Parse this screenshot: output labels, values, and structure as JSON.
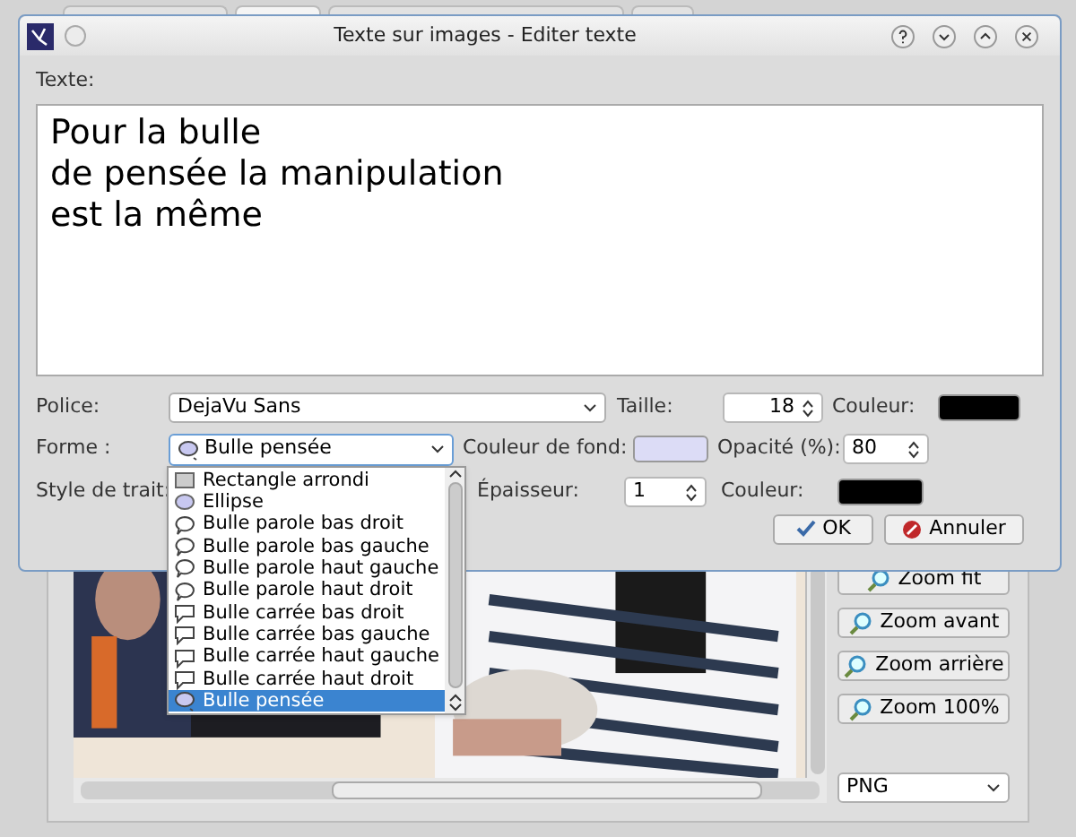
{
  "dialog": {
    "title": "Texte sur images - Editer texte",
    "text_label": "Texte:",
    "text": "Pour la bulle\nde pensée la manipulation\nest la même",
    "font": {
      "label": "Police:",
      "value": "DejaVu Sans"
    },
    "size": {
      "label": "Taille:",
      "value": "18"
    },
    "color": {
      "label": "Couleur:",
      "color": "#000000"
    },
    "shape": {
      "label": "Forme :",
      "value": "Bulle pensée"
    },
    "background_color": {
      "label": "Couleur de fond:",
      "color": "#dcdcf6"
    },
    "opacity": {
      "label": "Opacité (%):",
      "value": "80"
    },
    "stroke_style": {
      "label": "Style de trait:"
    },
    "thickness": {
      "label": "Épaisseur:",
      "value": "1"
    },
    "stroke_color": {
      "label": "Couleur:",
      "color": "#000000"
    },
    "buttons": [
      {
        "label": "OK",
        "kind": "ok"
      },
      {
        "label": "Annuler",
        "kind": "cancel"
      }
    ]
  },
  "shape_list": [
    {
      "label": "Rectangle arrondi",
      "kind": "rect",
      "selected": false
    },
    {
      "label": "Ellipse",
      "kind": "ellipse",
      "selected": false
    },
    {
      "label": "Bulle parole bas droit",
      "kind": "speech",
      "selected": false
    },
    {
      "label": "Bulle parole bas gauche",
      "kind": "speech",
      "selected": false
    },
    {
      "label": "Bulle parole haut gauche",
      "kind": "speech",
      "selected": false
    },
    {
      "label": "Bulle parole haut droit",
      "kind": "speech",
      "selected": false
    },
    {
      "label": "Bulle carrée bas droit",
      "kind": "square",
      "selected": false
    },
    {
      "label": "Bulle carrée bas gauche",
      "kind": "square",
      "selected": false
    },
    {
      "label": "Bulle carrée haut gauche",
      "kind": "square",
      "selected": false
    },
    {
      "label": "Bulle carrée haut droit",
      "kind": "square",
      "selected": false
    },
    {
      "label": "Bulle pensée",
      "kind": "thought",
      "selected": true
    }
  ],
  "zoom_buttons": [
    "Zoom fit",
    "Zoom avant",
    "Zoom arrière",
    "Zoom 100%"
  ],
  "format": "PNG",
  "tabs": [
    {
      "selected": false
    },
    {
      "selected": true
    },
    {
      "selected": false
    },
    {
      "selected": false
    }
  ]
}
